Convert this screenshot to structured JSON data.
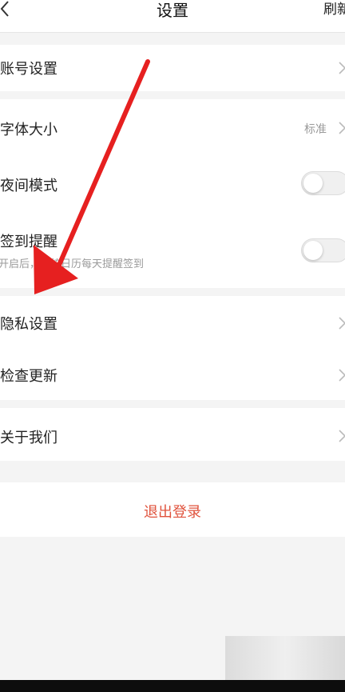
{
  "header": {
    "title": "设置",
    "right_action": "刷新",
    "back_icon": "chevron-left-icon"
  },
  "settings": {
    "account": {
      "label": "账号设置"
    },
    "font_size": {
      "label": "字体大小",
      "value": "标准"
    },
    "night_mode": {
      "label": "夜间模式",
      "enabled": false
    },
    "checkin_reminder": {
      "label": "签到提醒",
      "description": "开启后，系统日历每天提醒签到",
      "enabled": false
    },
    "privacy": {
      "label": "隐私设置"
    },
    "check_update": {
      "label": "检查更新"
    },
    "about": {
      "label": "关于我们"
    }
  },
  "logout": {
    "label": "退出登录",
    "color": "#e0533d"
  },
  "annotation": {
    "arrow_color": "#e62020",
    "points_to": "隐私设置"
  }
}
